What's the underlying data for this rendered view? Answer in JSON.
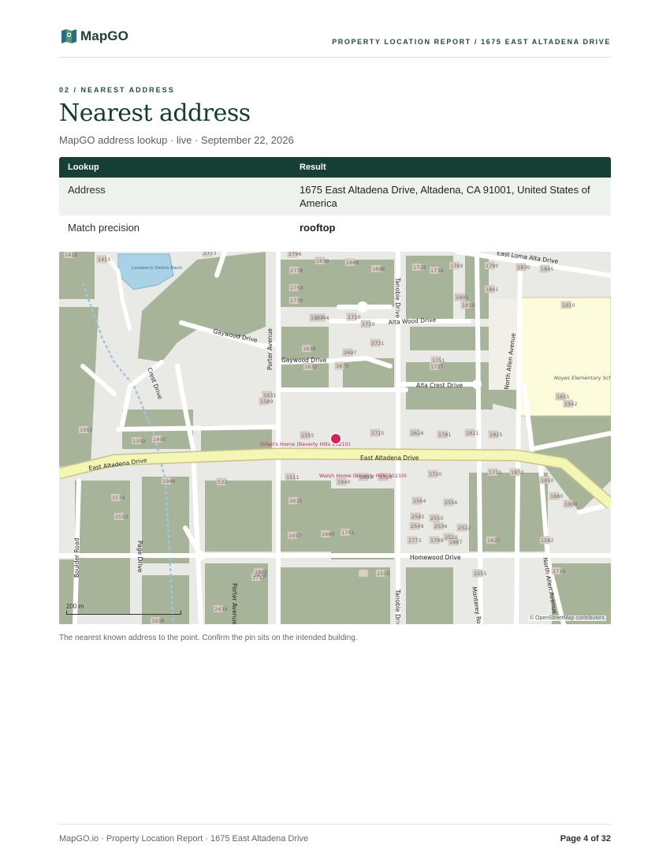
{
  "header": {
    "brand": "MapGO",
    "report_label": "PROPERTY LOCATION REPORT / 1675 EAST ALTADENA DRIVE"
  },
  "section": {
    "eyebrow": "02 / NEAREST ADDRESS",
    "title": "Nearest address",
    "subtitle": "MapGO address lookup · live · September 22, 2026"
  },
  "table": {
    "headers": [
      "Lookup",
      "Result"
    ],
    "rows": [
      {
        "label": "Address",
        "value": "1675 East Altadena Drive, Altadena, CA 91001, United States of America"
      },
      {
        "label": "Match precision",
        "value": "rooftop"
      }
    ]
  },
  "map": {
    "streets": {
      "east_altadena": "East Altadena Drive",
      "east_altadena_west": "East Altadena Drive",
      "gaywood": "Gaywood Drive",
      "gaywood_2": "Gaywood Drive",
      "alta_wood": "Alta Wood Drive",
      "alta_crest": "Alta Crest Drive",
      "porter": "Porter Avenue",
      "porter_south": "Porter Avenue",
      "tanoble": "Tanoble Drive",
      "tanoble_south": "Tanoble Drive",
      "north_allen": "North Allen Avenue",
      "north_allen_south": "North Allen Avenue",
      "crest": "Crest Drive",
      "page": "Page Drive",
      "boulder": "Boulder Road",
      "homewood": "Homewood Drive",
      "monterey": "Monterey Road",
      "east_loma_alta": "East Loma Alta Drive"
    },
    "pois": {
      "school": "Noyes Elementary School",
      "basin": "Loneberry Debris Basin",
      "wash": "Walsh Home (Beverly Hills 90210)",
      "orlans": "Orlan's Home (Beverly Hills 90210)"
    },
    "house_numbers": [
      "1412",
      "1415",
      "2773",
      "2796",
      "1630",
      "1666",
      "1696",
      "1724",
      "1734",
      "1769",
      "1790",
      "1830",
      "1845",
      "2778",
      "2759",
      "2739",
      "1807",
      "1801",
      "1819",
      "1841",
      "1910",
      "1710",
      "1744",
      "1720",
      "2731",
      "1639",
      "1632",
      "2697",
      "1675",
      "1727",
      "1751",
      "1631",
      "1589",
      "1555",
      "1715",
      "2626",
      "1781",
      "1811",
      "1825",
      "1855",
      "1942",
      "1953",
      "1309",
      "1495",
      "1511",
      "1840",
      "1890",
      "1720",
      "1720",
      "1770",
      "1870",
      "1850",
      "1880",
      "1900",
      "1946",
      "532",
      "1574",
      "2615",
      "2564",
      "2556",
      "2553",
      "2585",
      "2550",
      "2536",
      "2549",
      "2522",
      "2520",
      "1827",
      "1657",
      "1680",
      "1751",
      "1773",
      "1799",
      "1887",
      "1582",
      "1600",
      "2475",
      "1555",
      "2434",
      "1938",
      "1717",
      "1714",
      "1555"
    ],
    "scale_label": "200 m",
    "attribution": "© OpenStreetMap contributors",
    "colors": {
      "land": "#ecebe7",
      "residential": "#dcdcd7",
      "park": "#a8b49a",
      "school": "#fcfbdc",
      "major_road": "#f4f6b5",
      "major_road_casing": "#c9c48a",
      "building": "#d9cfc7",
      "pin": "#d1245a"
    }
  },
  "caption": "The nearest known address to the point. Confirm the pin sits on the intended building.",
  "footer": {
    "left": "MapGO.io · Property Location Report · 1675 East Altadena Drive",
    "right": "Page 4 of 32"
  }
}
